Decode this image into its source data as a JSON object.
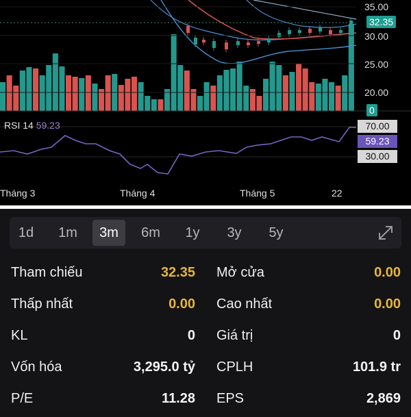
{
  "colors": {
    "up": "#23998e",
    "down": "#d9534f",
    "rsi_line": "#7a63c6",
    "accent_yellow": "#e8b53a",
    "price_badge": "#1e9e91"
  },
  "price_axis": {
    "ticks": [
      "35.00",
      "30.00",
      "25.00",
      "20.00"
    ],
    "current_price": "32.35",
    "volume_zero": "0"
  },
  "rsi": {
    "label": "RSI 14",
    "value": "59.23",
    "levels": [
      "70.00",
      "59.23",
      "30.00"
    ]
  },
  "x_axis": [
    "Tháng 3",
    "Tháng 4",
    "Tháng 5",
    "22"
  ],
  "timeframes": {
    "items": [
      "1d",
      "1m",
      "3m",
      "6m",
      "1y",
      "3y",
      "5y"
    ],
    "selected": "3m"
  },
  "stats": {
    "tham_chieu": {
      "label": "Tham chiếu",
      "value": "32.35"
    },
    "mo_cua": {
      "label": "Mở cửa",
      "value": "0.00"
    },
    "thap_nhat": {
      "label": "Thấp nhất",
      "value": "0.00"
    },
    "cao_nhat": {
      "label": "Cao nhất",
      "value": "0.00"
    },
    "kl": {
      "label": "KL",
      "value": "0"
    },
    "gia_tri": {
      "label": "Giá trị",
      "value": "0"
    },
    "von_hoa": {
      "label": "Vốn hóa",
      "value": "3,295.0 tỷ"
    },
    "cplh": {
      "label": "CPLH",
      "value": "101.9 tr"
    },
    "pe": {
      "label": "P/E",
      "value": "11.28"
    },
    "eps": {
      "label": "EPS",
      "value": "2,869"
    }
  }
}
